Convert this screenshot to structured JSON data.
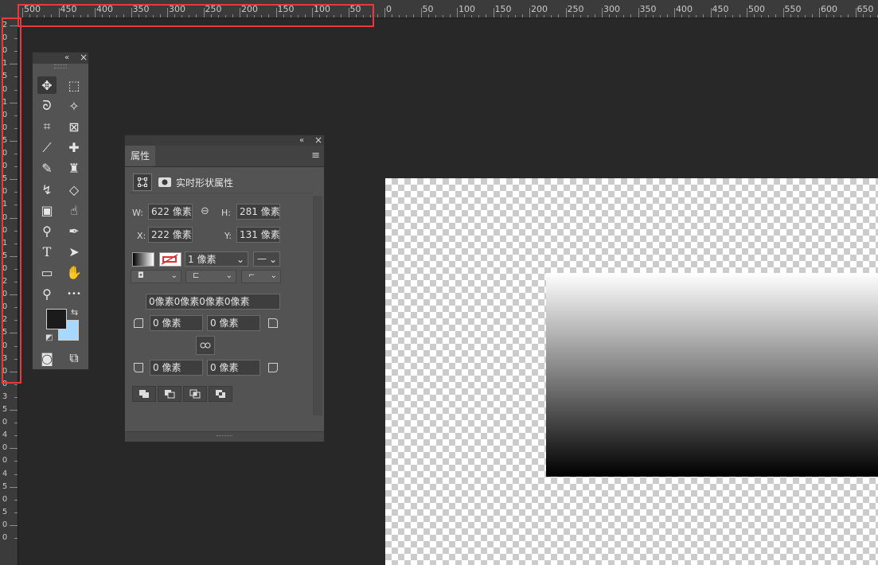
{
  "rulers": {
    "top_labels": [
      "500",
      "450",
      "400",
      "350",
      "300",
      "250",
      "200",
      "150",
      "100",
      "50",
      "0",
      "50",
      "100",
      "150",
      "200",
      "250",
      "300",
      "350",
      "400",
      "450",
      "500",
      "550",
      "600",
      "650"
    ],
    "left_labels": [
      "2",
      "0",
      "0",
      "1",
      "5",
      "0",
      "1",
      "0",
      "0",
      "5",
      "0",
      "0",
      "5",
      "0",
      "1",
      "0",
      "0",
      "1",
      "5",
      "0",
      "2",
      "0",
      "0",
      "2",
      "5",
      "0",
      "3",
      "0",
      "0",
      "3",
      "5",
      "0",
      "4",
      "0",
      "0",
      "4",
      "5",
      "0",
      "5",
      "0",
      "0"
    ]
  },
  "toolbar": {
    "collapse_icon": "«",
    "close_icon": "×",
    "tools": [
      {
        "name": "move-tool",
        "glyph": "✥"
      },
      {
        "name": "marquee-tool",
        "glyph": "⬚"
      },
      {
        "name": "lasso-tool",
        "glyph": "ᘐ"
      },
      {
        "name": "magic-wand-tool",
        "glyph": "✧"
      },
      {
        "name": "crop-tool",
        "glyph": "⌗"
      },
      {
        "name": "frame-tool",
        "glyph": "⊠"
      },
      {
        "name": "eyedropper-tool",
        "glyph": "⟋"
      },
      {
        "name": "healing-brush-tool",
        "glyph": "✚"
      },
      {
        "name": "brush-tool",
        "glyph": "✎"
      },
      {
        "name": "stamp-tool",
        "glyph": "♜"
      },
      {
        "name": "history-brush-tool",
        "glyph": "↯"
      },
      {
        "name": "eraser-tool",
        "glyph": "◇"
      },
      {
        "name": "gradient-tool",
        "glyph": "▣"
      },
      {
        "name": "smudge-tool",
        "glyph": "☝"
      },
      {
        "name": "dodge-tool",
        "glyph": "⚲"
      },
      {
        "name": "pen-tool",
        "glyph": "✒"
      },
      {
        "name": "type-tool",
        "glyph": "T"
      },
      {
        "name": "path-select-tool",
        "glyph": "➤"
      },
      {
        "name": "rectangle-tool",
        "glyph": "▭"
      },
      {
        "name": "hand-tool",
        "glyph": "✋"
      },
      {
        "name": "zoom-tool",
        "glyph": "⚲"
      },
      {
        "name": "more-tools",
        "glyph": "•••"
      },
      {
        "name": "quick-mask-tool",
        "glyph": "◙"
      },
      {
        "name": "screen-mode-tool",
        "glyph": "⧉"
      }
    ],
    "colors": {
      "foreground": "#1b1b1b",
      "background": "#a8d8ff"
    }
  },
  "properties": {
    "collapse_icon": "«",
    "close_icon": "×",
    "tab_label": "属性",
    "menu_icon": "≡",
    "section_title": "实时形状属性",
    "w_label": "W:",
    "w_value": "622 像素",
    "h_label": "H:",
    "h_value": "281 像素",
    "x_label": "X:",
    "x_value": "222 像素",
    "y_label": "Y:",
    "y_value": "131 像素",
    "stroke_width": "1 像素",
    "corner_all": "0像素0像素0像素0像素",
    "corner_tl": "0 像素",
    "corner_tr": "0 像素",
    "corner_bl": "0 像素",
    "corner_br": "0 像素"
  }
}
